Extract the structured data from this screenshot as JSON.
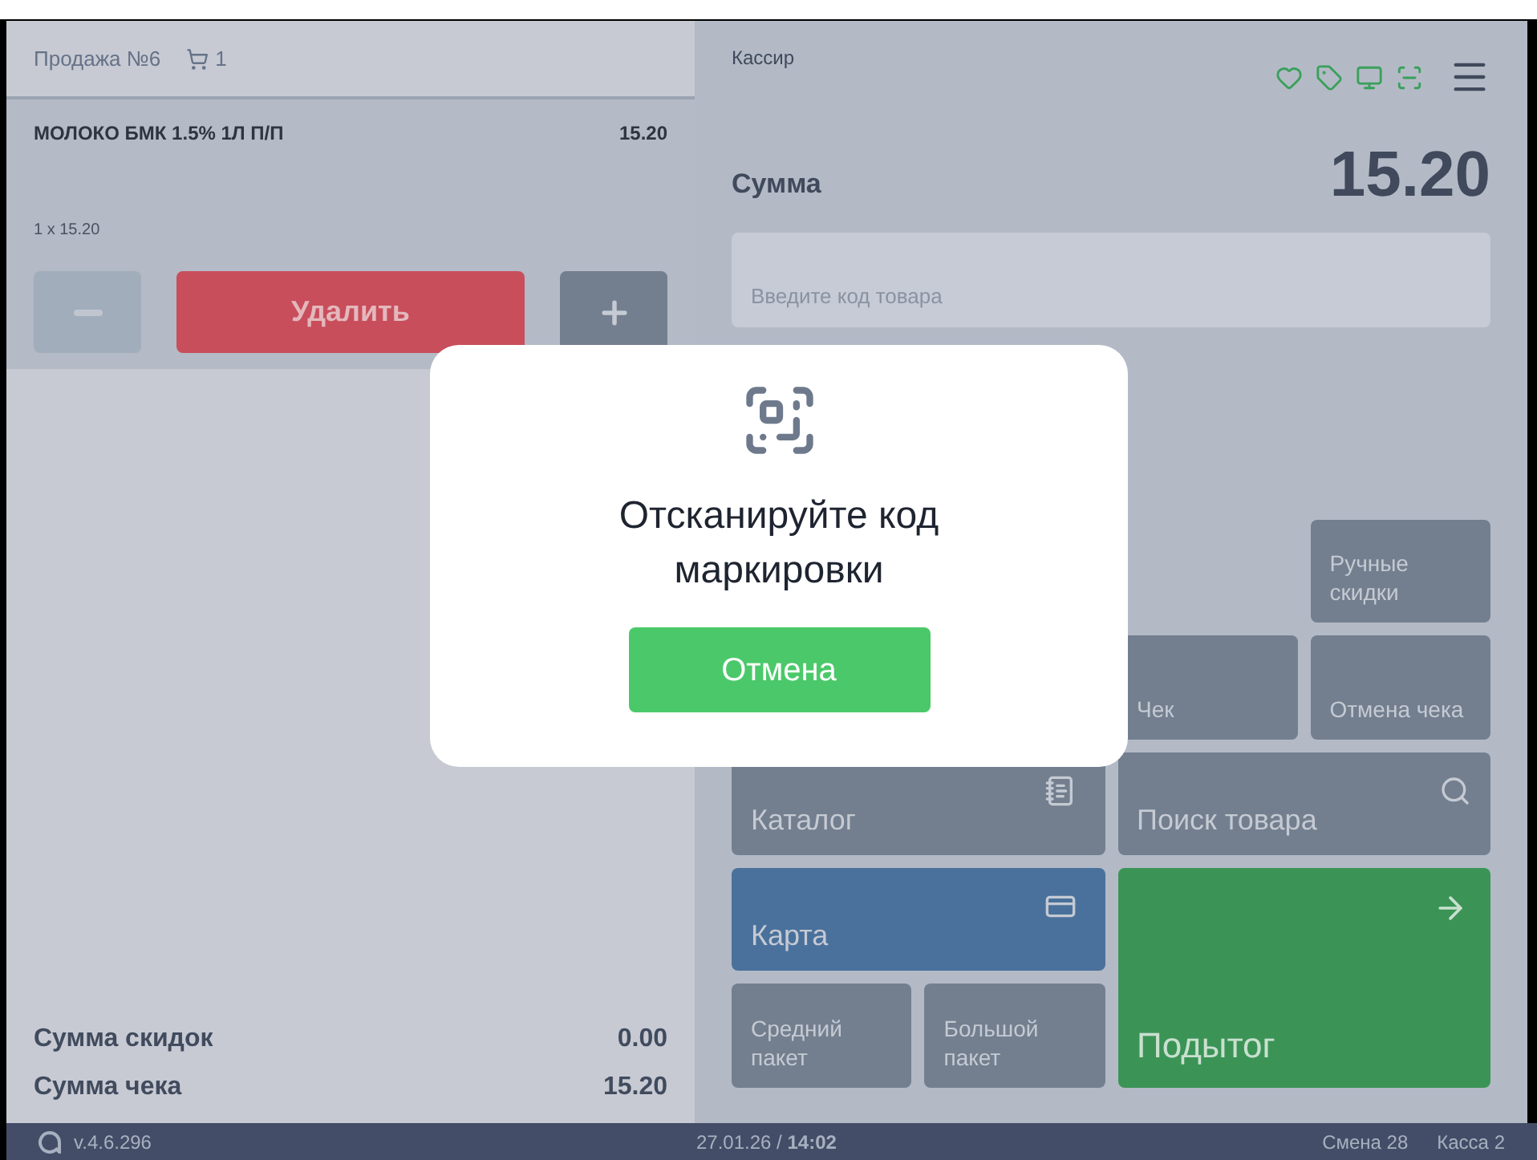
{
  "sale": {
    "title": "Продажа №6",
    "cart_count": "1"
  },
  "item": {
    "name": "МОЛОКО БМК 1.5% 1Л П/П",
    "price": "15.20",
    "quantity_line": "1 x 15.20",
    "selected": true
  },
  "item_buttons": [
    {
      "kind": "minus",
      "disabled": true
    },
    {
      "kind": "delete",
      "label": "Удалить",
      "disabled": false
    },
    {
      "kind": "plus",
      "disabled": false
    }
  ],
  "totals": [
    {
      "label": "Сумма скидок",
      "value": "0.00"
    },
    {
      "label": "Сумма чека",
      "value": "15.20"
    }
  ],
  "header": {
    "user": "Кассир",
    "status_icons": [
      {
        "kind": "heart"
      },
      {
        "kind": "tag"
      },
      {
        "kind": "monitor"
      },
      {
        "kind": "scan"
      }
    ]
  },
  "sum": {
    "label": "Сумма",
    "value": "15.20"
  },
  "code_field": {
    "placeholder": "Введите код товара"
  },
  "actions": [
    {
      "label": "Ручные скидки",
      "kind": "small"
    },
    {
      "label": "Чек",
      "kind": "small"
    },
    {
      "label": "Отмена чека",
      "kind": "small"
    },
    {
      "label": "Каталог",
      "kind": "catalog"
    },
    {
      "label": "Поиск товара",
      "kind": "search"
    },
    {
      "label": "Карта",
      "kind": "card"
    },
    {
      "label": "Средний пакет",
      "kind": "small"
    },
    {
      "label": "Большой пакет",
      "kind": "small"
    },
    {
      "label": "Подытог",
      "kind": "subtotal"
    }
  ],
  "dialog": {
    "title": "Отсканируйте код маркировки",
    "button": "Отмена"
  },
  "status_bar": {
    "version": "v.4.6.296",
    "datetime": "27.01.26 / **14:02**",
    "shift": "Смена 28",
    "register": "Касса 2"
  }
}
